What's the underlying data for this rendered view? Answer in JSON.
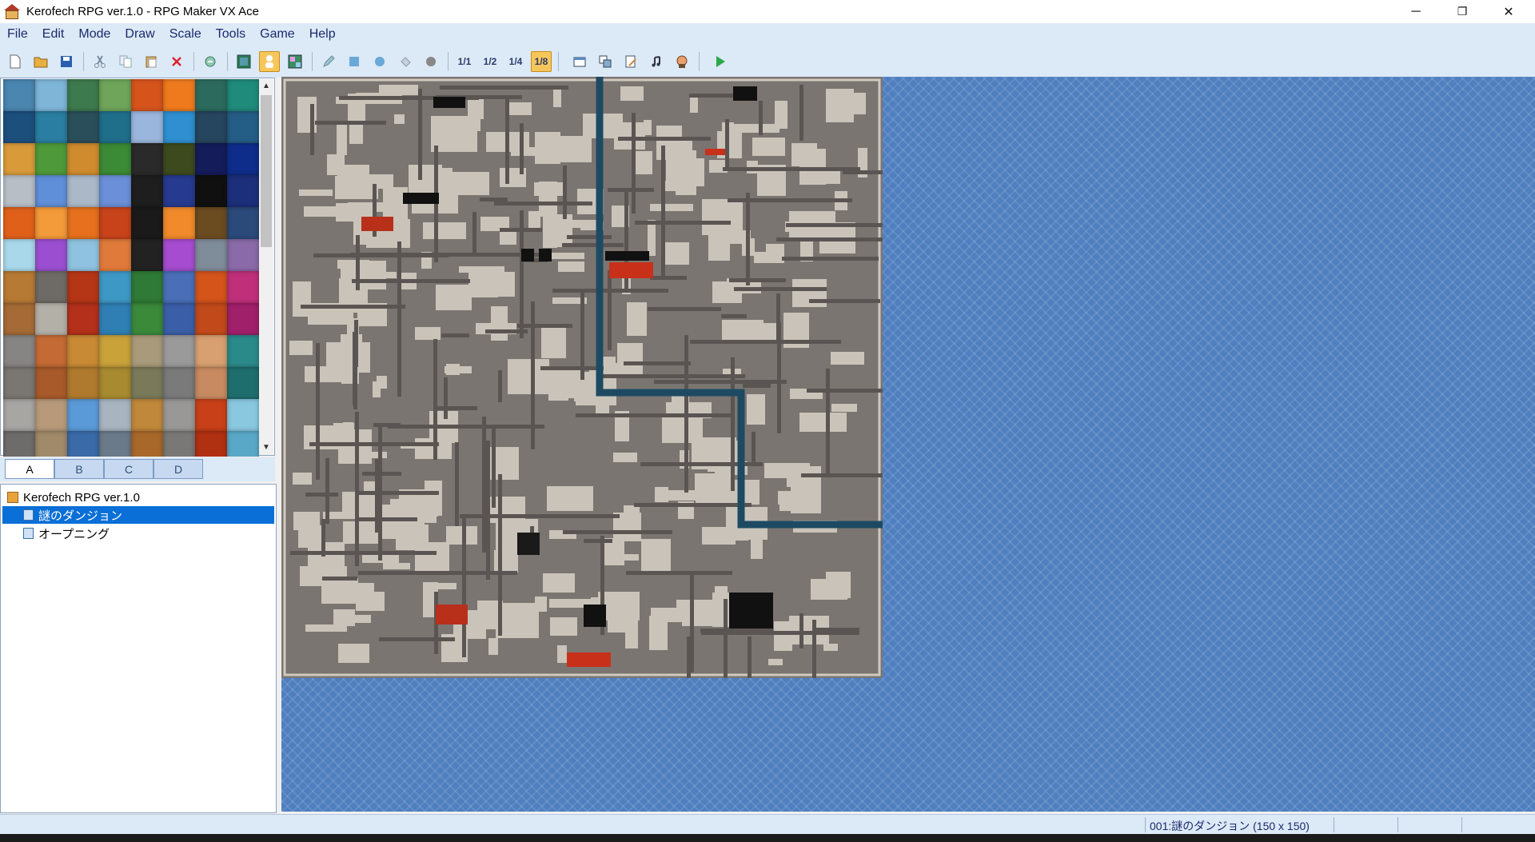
{
  "window": {
    "title": "Kerofech RPG ver.1.0 - RPG Maker VX Ace",
    "minimize": "─",
    "restore": "❐",
    "close": "✕"
  },
  "menu": [
    "File",
    "Edit",
    "Mode",
    "Draw",
    "Scale",
    "Tools",
    "Game",
    "Help"
  ],
  "toolbar": {
    "groups": [
      [
        "new-project-icon",
        "open-project-icon",
        "save-project-icon"
      ],
      [
        "cut-icon",
        "copy-icon",
        "paste-icon",
        "delete-icon"
      ],
      [
        "undo-icon"
      ],
      [
        "map-mode-icon",
        "event-mode-icon",
        "region-mode-icon"
      ],
      [
        "pencil-icon",
        "rectangle-icon",
        "ellipse-icon",
        "flood-fill-icon",
        "shadow-pen-icon"
      ],
      [
        "scale-1-1-icon",
        "scale-1-2-icon",
        "scale-1-4-icon",
        "scale-1-8-icon"
      ],
      [
        "database-icon",
        "resource-manager-icon",
        "script-editor-icon",
        "sound-test-icon",
        "character-generator-icon"
      ],
      [
        "playtest-icon"
      ]
    ],
    "active": [
      "event-mode-icon",
      "scale-1-8-icon"
    ],
    "scale_labels": {
      "scale-1-1-icon": "1/1",
      "scale-1-2-icon": "1/2",
      "scale-1-4-icon": "1/4",
      "scale-1-8-icon": "1/8"
    }
  },
  "tileset": {
    "tabs": [
      "A",
      "B",
      "C",
      "D"
    ],
    "active_tab": "A",
    "tile_colors": [
      "#4a86b0",
      "#7fb6d8",
      "#3d7a4e",
      "#6fa55a",
      "#d6541c",
      "#ef7a1e",
      "#2c6a5e",
      "#1f8b7a",
      "#1d4f7d",
      "#2a7ea1",
      "#2b4f5a",
      "#1f6f8b",
      "#9bb6dd",
      "#2f8fd0",
      "#26455f",
      "#245d85",
      "#d99a3a",
      "#4e9a3a",
      "#d08b2e",
      "#3b8a35",
      "#2a2a2a",
      "#3d4a1e",
      "#141c5a",
      "#0e2d8a",
      "#b8bec6",
      "#5f8fd8",
      "#aab8c8",
      "#6b8fd8",
      "#1e1e1e",
      "#263a8f",
      "#101010",
      "#1c2f7a",
      "#e0601a",
      "#f39a3a",
      "#e6701e",
      "#c8431a",
      "#1a1a1a",
      "#f08a2a",
      "#6b4b20",
      "#2b4a7a",
      "#a8d8ea",
      "#9b4fd0",
      "#8fc2e0",
      "#e07a3a",
      "#222222",
      "#a64cd0",
      "#7f8c99",
      "#8a6aa8",
      "#b77a35",
      "#6e6b66",
      "#b53616",
      "#3e98c6",
      "#2f7a36",
      "#4a6fb8",
      "#d4541a",
      "#c0307a",
      "#a56a35",
      "#b3b0a8",
      "#b4301a",
      "#2f7fb4",
      "#3a8a3a",
      "#3b5ea8",
      "#c24a1a",
      "#a0206a",
      "#878583",
      "#c46a35",
      "#c98a35",
      "#c9a23a",
      "#a89a7a",
      "#9a9a9a",
      "#d8a070",
      "#2a8a8a",
      "#7a7672",
      "#a85a2a",
      "#b07a2e",
      "#a88a30",
      "#7a7a5a",
      "#7a7a7a",
      "#c88a60",
      "#1f6e6e",
      "#a8a6a3",
      "#b89a7a",
      "#5a9ad8",
      "#a8b4c0",
      "#c0883a",
      "#9a9896",
      "#c84018",
      "#8ac8e0",
      "#6e6c6a",
      "#a08a6a",
      "#3a6aa8",
      "#6a7a8a",
      "#a8682a",
      "#7a7876",
      "#b03012",
      "#5aa8c8"
    ]
  },
  "map_tree": {
    "project": "Kerofech RPG ver.1.0",
    "maps": [
      {
        "name": "謎のダンジョン",
        "selected": true
      },
      {
        "name": "オープニング",
        "selected": false
      }
    ]
  },
  "status": {
    "text": "001:謎のダンジョン (150 x 150)"
  }
}
